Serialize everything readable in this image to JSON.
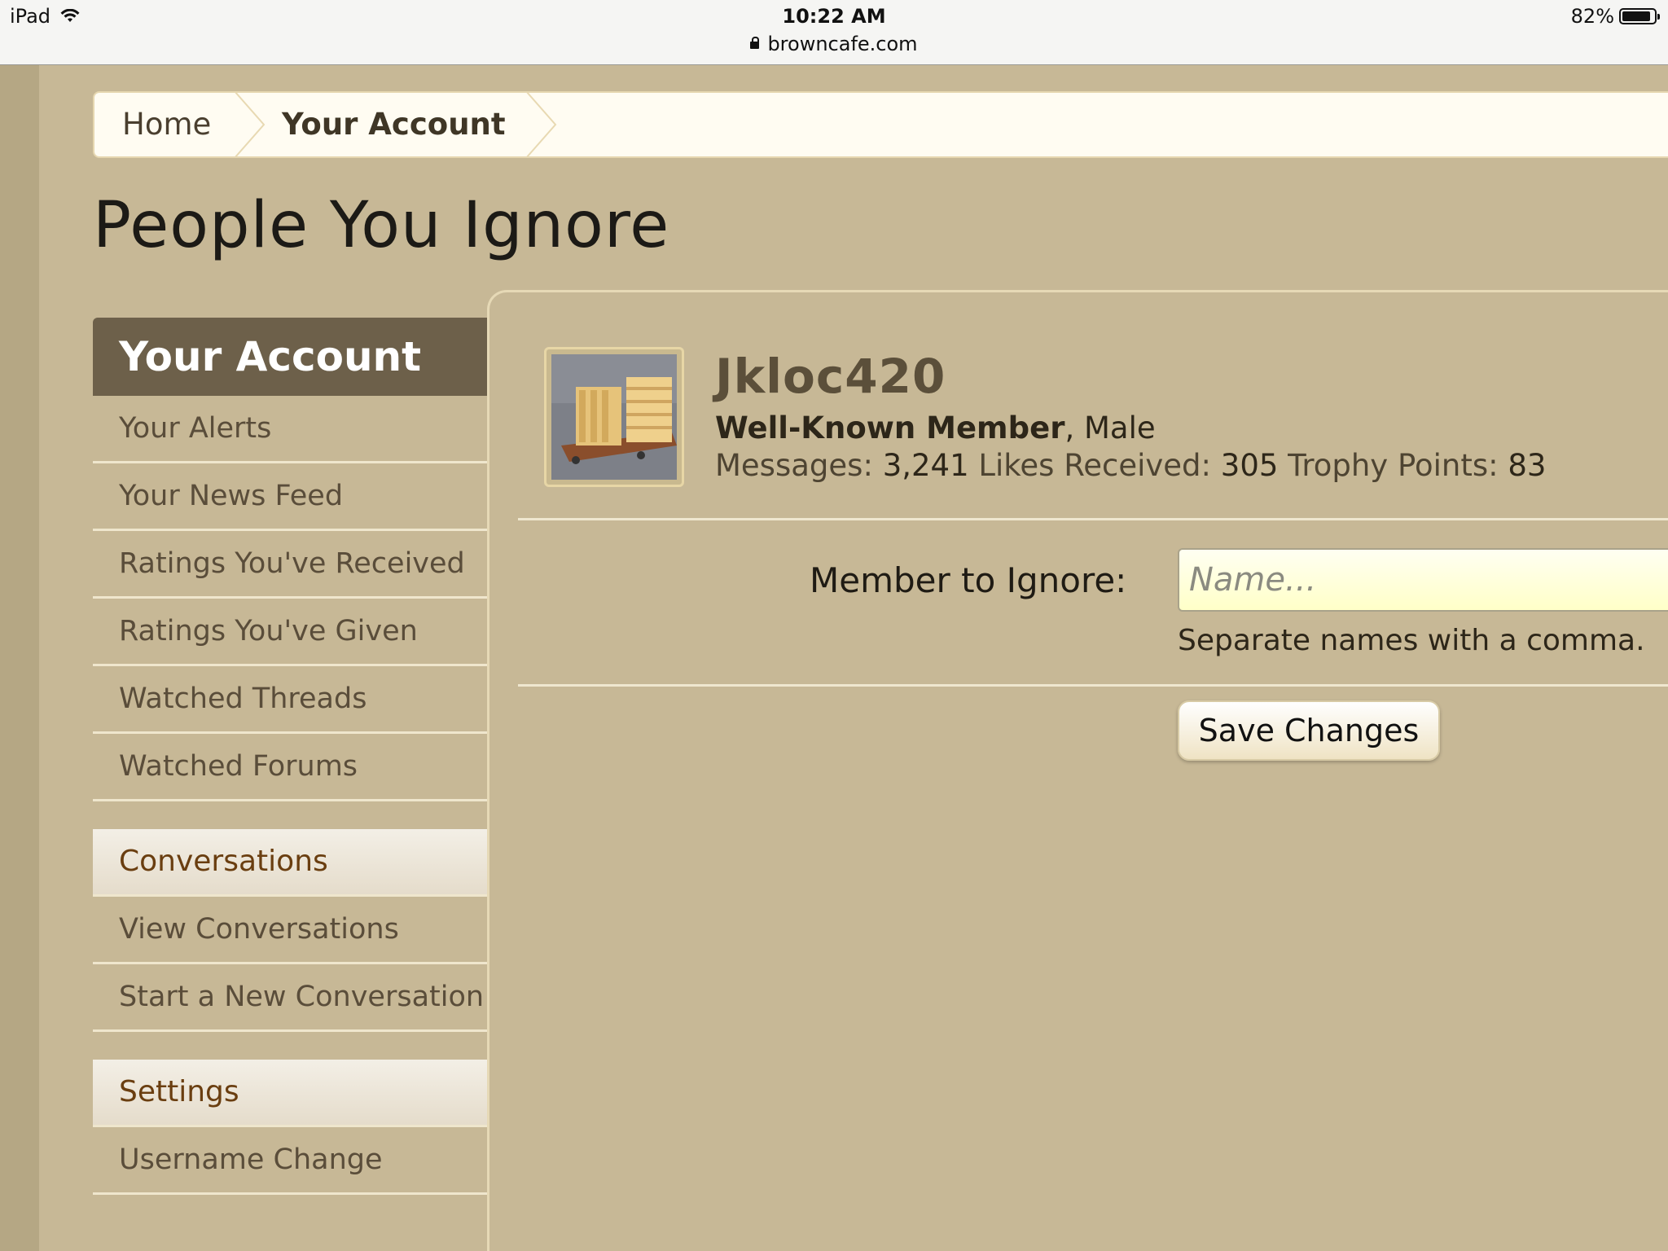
{
  "status_bar": {
    "device": "iPad",
    "time": "10:22 AM",
    "url": "browncafe.com",
    "battery": "82%"
  },
  "breadcrumb": {
    "home": "Home",
    "current": "Your Account"
  },
  "page_title": "People You Ignore",
  "sidebar": {
    "header": "Your Account",
    "items": [
      "Your Alerts",
      "Your News Feed",
      "Ratings You've Received",
      "Ratings You've Given",
      "Watched Threads",
      "Watched Forums"
    ],
    "conversations_header": "Conversations",
    "conversations_items": [
      "View Conversations",
      "Start a New Conversation"
    ],
    "settings_header": "Settings",
    "settings_items": [
      "Username Change"
    ]
  },
  "profile": {
    "username": "Jkloc420",
    "rank": "Well-Known Member",
    "gender": ", Male",
    "messages_label": "Messages:",
    "messages": "3,241",
    "likes_label": "Likes Received:",
    "likes": "305",
    "trophy_label": "Trophy Points:",
    "trophy": "83"
  },
  "form": {
    "label": "Member to Ignore:",
    "placeholder": "Name...",
    "hint": "Separate names with a comma.",
    "save_label": "Save Changes"
  },
  "colors": {
    "page_bg": "#c7b896",
    "sidebar_header_bg": "#6d604a",
    "section_link": "#6a3e10",
    "input_bg": "#ffffc8"
  }
}
